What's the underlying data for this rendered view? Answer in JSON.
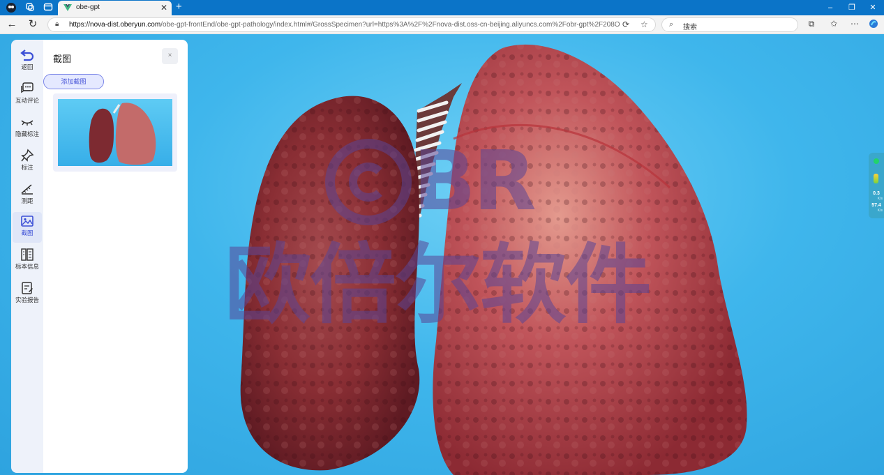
{
  "browser": {
    "tab_title": "obe-gpt",
    "url_host": "https://nova-dist.oberyun.com",
    "url_path": "/obe-gpt-frontEnd/obe-gpt-pathology/index.html#/GrossSpecimen?url=https%3A%2F%2Fnova-dist.oss-cn-beijing.aliyuncs.com%2Fobr-gpt%2F208OBEGPT%2...",
    "search_placeholder": "搜索"
  },
  "toolbar": {
    "items": [
      {
        "label": "返回",
        "icon": "undo-arrow-icon"
      },
      {
        "label": "互动评论",
        "icon": "comment-icon"
      },
      {
        "label": "隐藏标注",
        "icon": "closed-eye-icon"
      },
      {
        "label": "标注",
        "icon": "pin-icon"
      },
      {
        "label": "测距",
        "icon": "ruler-icon"
      },
      {
        "label": "截图",
        "icon": "image-icon"
      },
      {
        "label": "标本信息",
        "icon": "specimen-info-icon"
      },
      {
        "label": "实验报告",
        "icon": "report-icon"
      }
    ],
    "active_index": 5
  },
  "panel": {
    "title": "截图",
    "close_label": "×",
    "add_button": "添加截图"
  },
  "watermark": {
    "logo_text": "BR",
    "company_text": "欧倍尔软件"
  },
  "speed_widget": {
    "upload_value": "0.3",
    "upload_unit": "K/s",
    "download_value": "57.4",
    "download_unit": "K/s"
  },
  "colors": {
    "accent": "#4a57d8",
    "browser_blue": "#0b74c8",
    "viewport_bg": "#3fb6ec"
  }
}
